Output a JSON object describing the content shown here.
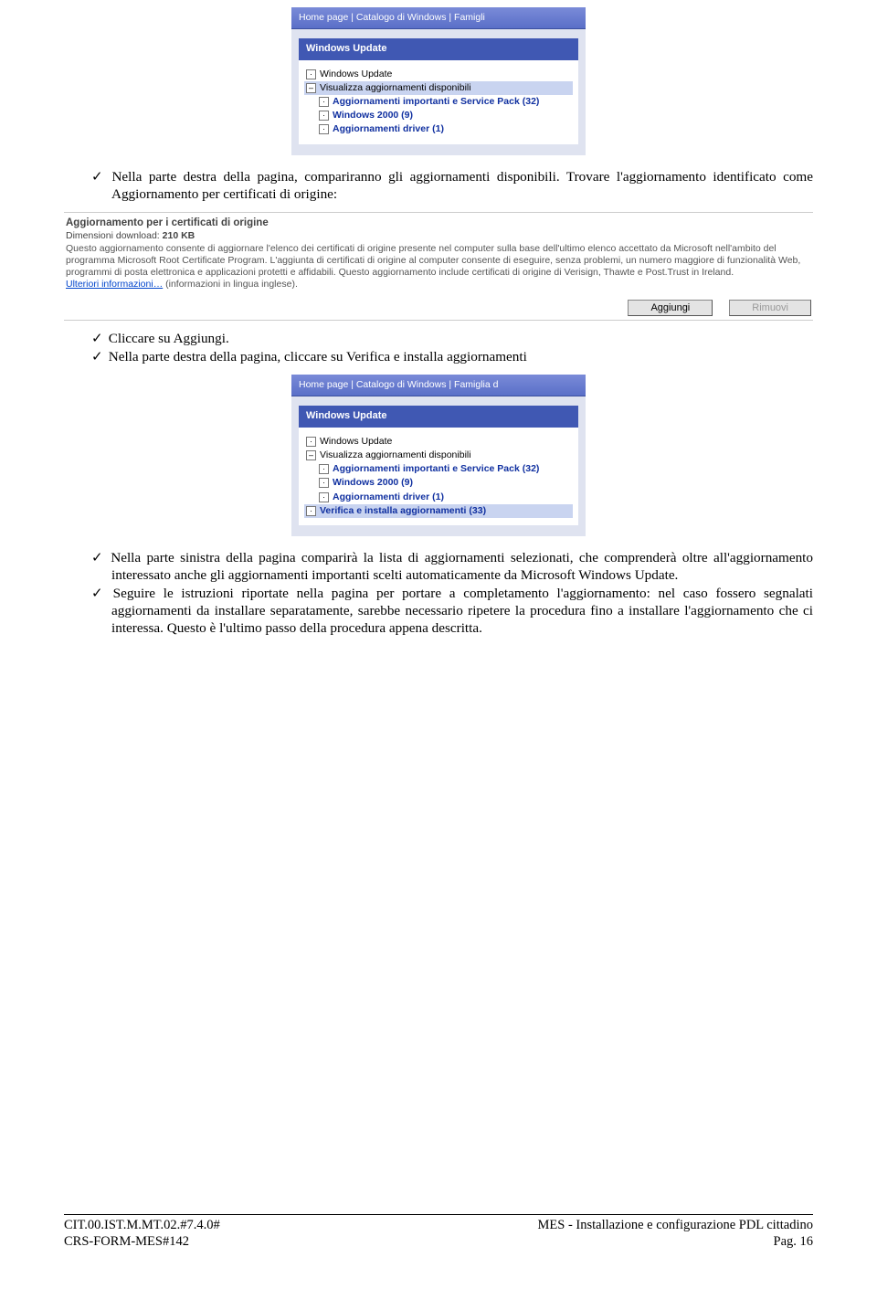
{
  "screenshot1": {
    "toolbar": "Home page  |  Catalogo di Windows  |  Famigli",
    "title": "Windows Update",
    "tree": [
      {
        "icon": "·",
        "label": "Windows Update",
        "indent": 0
      },
      {
        "icon": "–",
        "label": "Visualizza aggiornamenti disponibili",
        "indent": 0,
        "highlight": true
      },
      {
        "icon": "·",
        "label": "Aggiornamenti importanti e Service Pack (32)",
        "indent": 1,
        "bold": true
      },
      {
        "icon": "·",
        "label": "Windows 2000 (9)",
        "indent": 1,
        "bold": true
      },
      {
        "icon": "·",
        "label": "Aggiornamenti driver (1)",
        "indent": 1,
        "bold": true
      }
    ]
  },
  "bullets1": [
    "Nella parte destra della pagina, compariranno gli aggiornamenti disponibili. Trovare l'aggiornamento identificato come Aggiornamento per certificati di origine:"
  ],
  "certBlock": {
    "title": "Aggiornamento per i certificati di origine",
    "size_label": "Dimensioni download:",
    "size_value": "210 KB",
    "desc": "Questo aggiornamento consente di aggiornare l'elenco dei certificati di origine presente nel computer sulla base dell'ultimo elenco accettato da Microsoft nell'ambito del programma Microsoft Root Certificate Program. L'aggiunta di certificati di origine al computer consente di eseguire, senza problemi, un numero maggiore di funzionalità Web, programmi di posta elettronica e applicazioni protetti e affidabili. Questo aggiornamento include certificati di origine di Verisign, Thawte e Post.Trust in Ireland.",
    "link_text": "Ulteriori informazioni…",
    "link_note": " (informazioni in lingua inglese).",
    "btn_add": "Aggiungi",
    "btn_remove": "Rimuovi"
  },
  "bullets2": [
    "Cliccare su Aggiungi.",
    "Nella parte destra della pagina, cliccare su Verifica e installa aggiornamenti"
  ],
  "screenshot2": {
    "toolbar": "Home page  |  Catalogo di Windows  |  Famiglia d",
    "title": "Windows Update",
    "tree": [
      {
        "icon": "·",
        "label": "Windows Update",
        "indent": 0
      },
      {
        "icon": "–",
        "label": "Visualizza aggiornamenti disponibili",
        "indent": 0
      },
      {
        "icon": "·",
        "label": "Aggiornamenti importanti e Service Pack (32)",
        "indent": 1,
        "bold": true
      },
      {
        "icon": "·",
        "label": "Windows 2000 (9)",
        "indent": 1,
        "bold": true
      },
      {
        "icon": "·",
        "label": "Aggiornamenti driver (1)",
        "indent": 1,
        "bold": true
      },
      {
        "icon": "·",
        "label": "Verifica e installa aggiornamenti (33)",
        "indent": 0,
        "bold": true,
        "highlight": true
      }
    ]
  },
  "bullets3": [
    "Nella parte sinistra della pagina comparirà la lista di aggiornamenti selezionati, che comprenderà oltre all'aggiornamento interessato anche gli aggiornamenti importanti scelti automaticamente da Microsoft Windows Update.",
    "Seguire le istruzioni riportate nella pagina per portare a completamento l'aggiornamento: nel caso fossero segnalati aggiornamenti da installare separatamente, sarebbe necessario ripetere la procedura fino a installare l'aggiornamento che ci interessa. Questo è l'ultimo passo della procedura appena descritta."
  ],
  "footer": {
    "left1": "CIT.00.IST.M.MT.02.#7.4.0#",
    "left2": "CRS-FORM-MES#142",
    "right1": "MES - Installazione e configurazione PDL cittadino",
    "right2": "Pag. 16"
  }
}
